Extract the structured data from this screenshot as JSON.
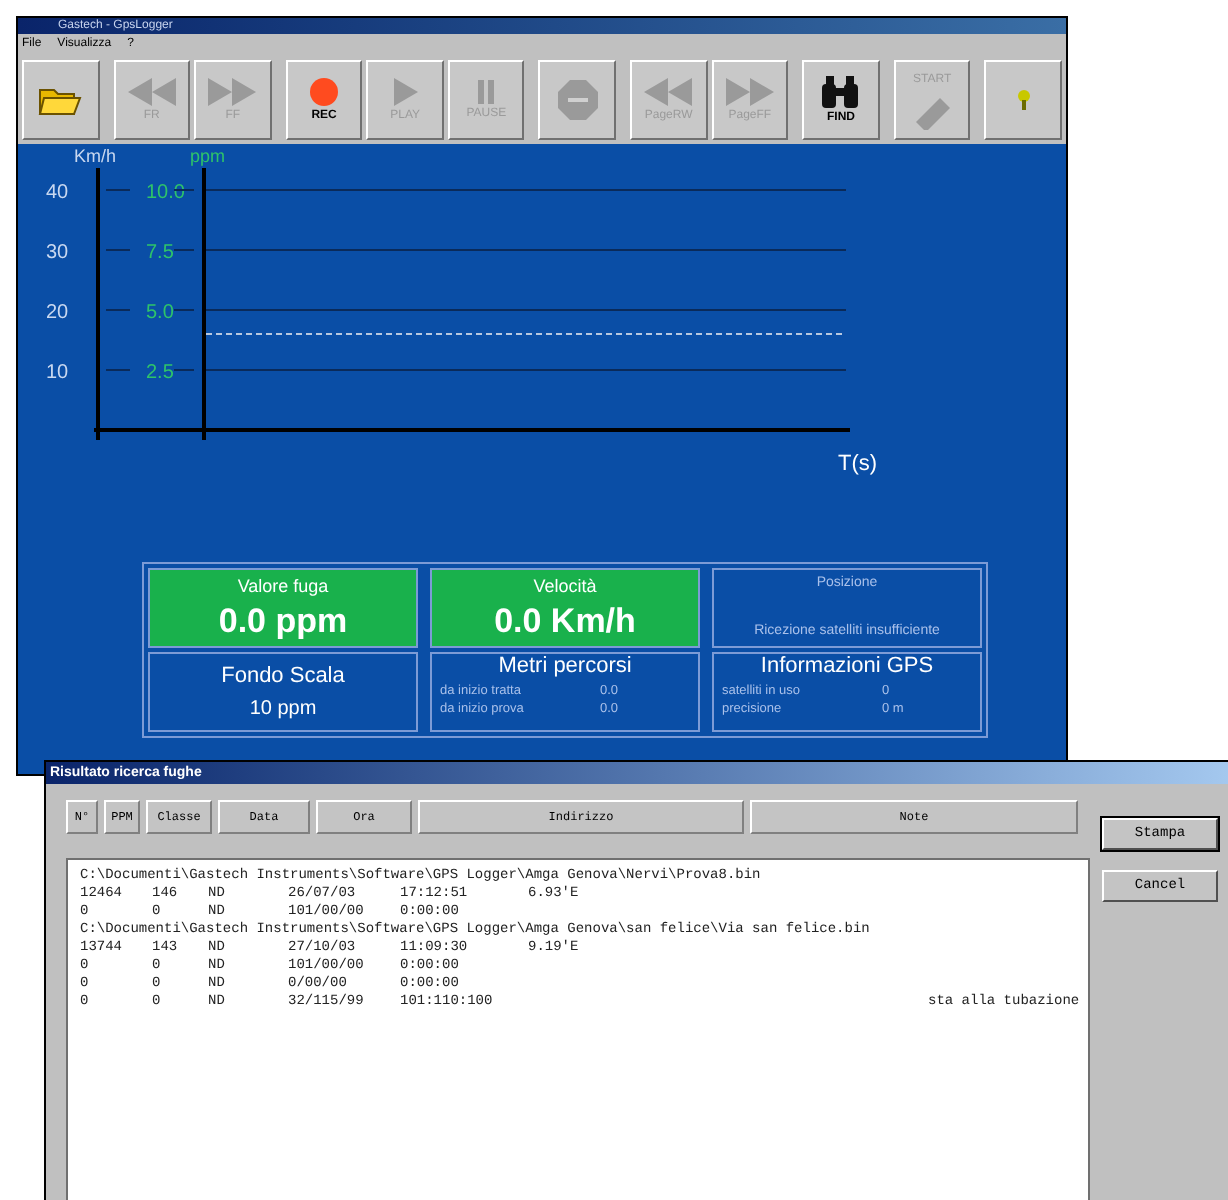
{
  "main_window": {
    "title": "Gastech - GpsLogger",
    "menu": [
      "File",
      "Visualizza",
      "?"
    ],
    "toolbar": [
      {
        "kind": "open",
        "disabled": false
      },
      {
        "kind": "rewind",
        "label": "FR",
        "disabled": true
      },
      {
        "kind": "forward",
        "label": "FF",
        "disabled": true
      },
      {
        "kind": "record",
        "label": "REC",
        "disabled": false
      },
      {
        "kind": "play",
        "label": "PLAY",
        "disabled": true
      },
      {
        "kind": "pause",
        "label": "PAUSE",
        "disabled": true
      },
      {
        "kind": "stop",
        "disabled": true
      },
      {
        "kind": "rewind",
        "label": "PageRW",
        "disabled": true
      },
      {
        "kind": "forward",
        "label": "PageFF",
        "disabled": true
      },
      {
        "kind": "find",
        "label": "FIND",
        "disabled": false
      },
      {
        "kind": "start",
        "label": "START",
        "disabled": true
      },
      {
        "kind": "help",
        "disabled": false
      }
    ],
    "graph": {
      "left_axis": {
        "label": "Km/h",
        "ticks": [
          "40",
          "30",
          "20",
          "10"
        ]
      },
      "right_axis": {
        "label": "ppm",
        "ticks": [
          "10.0",
          "7.5",
          "5.0",
          "2.5"
        ]
      },
      "x_label": "T(s)"
    },
    "panels": [
      {
        "kind": "value",
        "title": "Valore fuga",
        "value": "0.0 ppm"
      },
      {
        "kind": "value",
        "title": "Velocità",
        "value": "0.0 Km/h"
      },
      {
        "kind": "status",
        "title": "Posizione",
        "message": "Ricezione satelliti insufficiente"
      },
      {
        "kind": "scale",
        "title": "Fondo Scala",
        "value": "10 ppm"
      },
      {
        "kind": "info",
        "title": "Metri percorsi",
        "rows": [
          {
            "label": "da inizio tratta",
            "value": "0.0"
          },
          {
            "label": "da inizio prova",
            "value": "0.0"
          }
        ]
      },
      {
        "kind": "info",
        "title": "Informazioni GPS",
        "rows": [
          {
            "label": "satelliti in uso",
            "value": "0"
          },
          {
            "label": "precisione",
            "value": "0 m"
          }
        ]
      }
    ]
  },
  "results_window": {
    "title": "Risultato ricerca fughe",
    "columns": [
      "N°",
      "PPM",
      "Classe",
      "Data",
      "Ora",
      "Indirizzo",
      "Note"
    ],
    "lines": [
      {
        "kind": "path",
        "text": "C:\\Documenti\\Gastech Instruments\\Software\\GPS Logger\\Amga Genova\\Nervi\\Prova8.bin"
      },
      {
        "kind": "record",
        "cells": [
          "12464",
          "146",
          "ND",
          "26/07/03",
          "17:12:51",
          "6.93'E",
          null
        ]
      },
      {
        "kind": "record",
        "cells": [
          "0",
          "0",
          "ND",
          "101/00/00",
          "0:00:00",
          null,
          null
        ]
      },
      {
        "kind": "path",
        "text": "C:\\Documenti\\Gastech Instruments\\Software\\GPS Logger\\Amga Genova\\san felice\\Via san felice.bin"
      },
      {
        "kind": "record",
        "cells": [
          "13744",
          "143",
          "ND",
          "27/10/03",
          "11:09:30",
          "9.19'E",
          null
        ]
      },
      {
        "kind": "record",
        "cells": [
          "0",
          "0",
          "ND",
          "101/00/00",
          "0:00:00",
          null,
          null
        ]
      },
      {
        "kind": "record",
        "cells": [
          "0",
          "0",
          "ND",
          "0/00/00",
          "0:00:00",
          null,
          null
        ]
      },
      {
        "kind": "record",
        "cells": [
          "0",
          "0",
          "ND",
          "32/115/99",
          "101:110:100",
          null,
          "sta alla tubazione"
        ]
      }
    ],
    "buttons": [
      "Stampa",
      "Cancel"
    ]
  }
}
